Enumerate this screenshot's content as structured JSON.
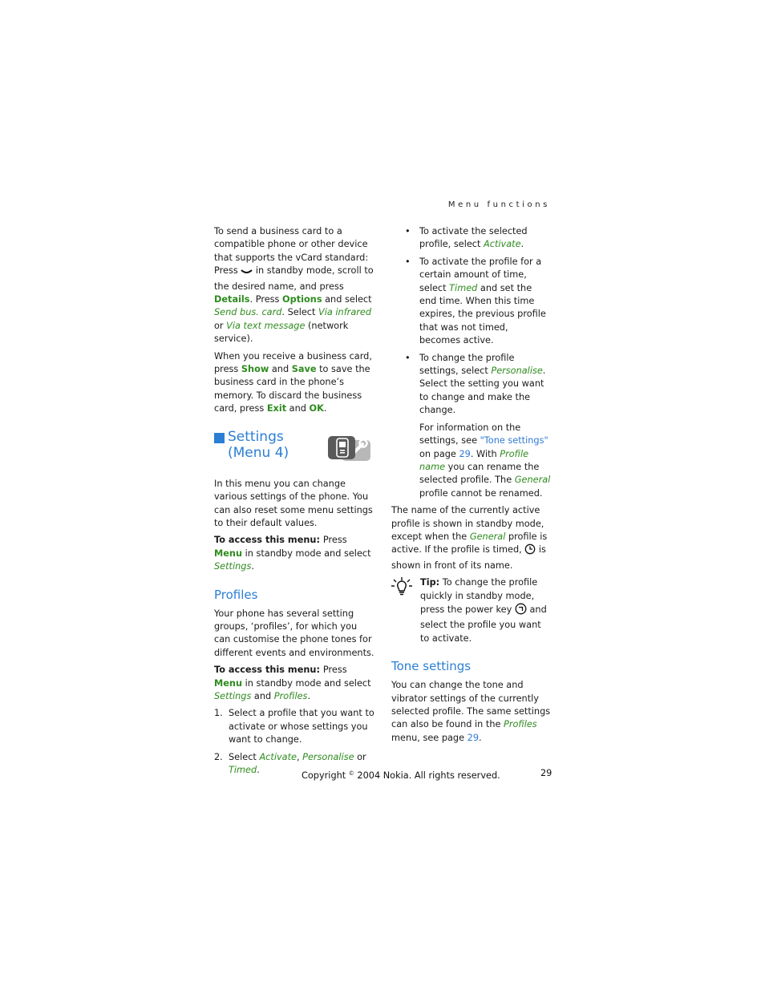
{
  "running_head": "Menu functions",
  "left": {
    "vcard_p1": {
      "t1": "To send a business card to a compatible phone or other device that supports the vCard standard: Press ",
      "t2": " in standby mode, scroll to the desired name, and press ",
      "details": "Details",
      "t3": ". Press ",
      "options": "Options",
      "t4": " and select ",
      "send_bus_card": "Send bus. card",
      "t5": ". Select ",
      "via_infrared": "Via infrared",
      "t6": " or ",
      "via_text_message": "Via text message",
      "t7": " (network service)."
    },
    "vcard_p2": {
      "t1": "When you receive a business card, press ",
      "show": "Show",
      "t2": " and ",
      "save": "Save",
      "t3": " to save the business card in the phone’s memory. To discard the business card, press ",
      "exit": "Exit",
      "t4": " and ",
      "ok": "OK",
      "t5": "."
    },
    "settings_heading": {
      "line1": "Settings",
      "line2": "(Menu 4)"
    },
    "settings_intro": "In this menu you can change various settings of the phone. You can also reset some menu settings to their default values.",
    "access1": {
      "label": "To access this menu: ",
      "t1": "Press ",
      "menu": "Menu",
      "t2": " in standby mode and select ",
      "settings": "Settings",
      "t3": "."
    },
    "profiles_heading": "Profiles",
    "profiles_intro": "Your phone has several setting groups, ‘profiles’, for which you can customise the phone tones for different events and environments.",
    "access2": {
      "label": "To access this menu: ",
      "t1": "Press ",
      "menu": "Menu",
      "t2": " in standby mode and select ",
      "settings": "Settings",
      "t3": " and ",
      "profiles": "Profiles",
      "t4": "."
    },
    "steps": [
      {
        "num": "1.",
        "text": "Select a profile that you want to activate or whose settings you want to change."
      },
      {
        "num": "2.",
        "t1": "Select ",
        "activate": "Activate",
        "t2": ", ",
        "personalise": "Personalise",
        "t3": " or ",
        "timed": "Timed",
        "t4": "."
      }
    ]
  },
  "right": {
    "bullet1": {
      "t1": "To activate the selected profile, select ",
      "activate": "Activate",
      "t2": "."
    },
    "bullet2": {
      "t1": "To activate the profile for a certain amount of time, select ",
      "timed": "Timed",
      "t2": " and set the end time. When this time expires, the previous profile that was not timed, becomes active."
    },
    "bullet3": {
      "t1": "To change the profile settings, select ",
      "personalise": "Personalise",
      "t2": ". Select the setting you want to change and make the change."
    },
    "info": {
      "t1": "For information on the settings, see ",
      "tone_link": "\"Tone settings\"",
      "t2": " on page ",
      "page": "29",
      "t3": ". With ",
      "profile_name": "Profile name",
      "t4": " you can rename the selected profile. The ",
      "general": "General",
      "t5": " profile cannot be renamed."
    },
    "active_name": {
      "t1": "The name of the currently active profile is shown in standby mode, except when the ",
      "general": "General",
      "t2": " profile is active. If the profile is timed, ",
      "t3": " is shown in front of its name."
    },
    "tip": {
      "label": "Tip:",
      "t1": " To change the profile quickly in standby mode, press the power key ",
      "t2": " and select the profile you want to activate."
    },
    "tone_heading": "Tone settings",
    "tone_p": {
      "t1": "You can change the tone and vibrator settings of the currently selected profile. The same settings can also be found in the ",
      "profiles": "Profiles",
      "t2": " menu, see page ",
      "page": "29",
      "t3": "."
    }
  },
  "footer": {
    "copy1": "Copyright ",
    "copy_sym": "©",
    "copy2": " 2004 Nokia. All rights reserved.",
    "page_number": "29"
  },
  "icons": {
    "scroll_key": "scroll-down-key-icon",
    "settings": "settings-phone-wrench-icon",
    "timer": "timer-clock-icon",
    "power_key": "power-key-icon",
    "tip": "lightbulb-tip-icon"
  },
  "colors": {
    "heading": "#2a7fd4",
    "softkey": "#2e8b1e",
    "link": "#2f7ad6"
  }
}
